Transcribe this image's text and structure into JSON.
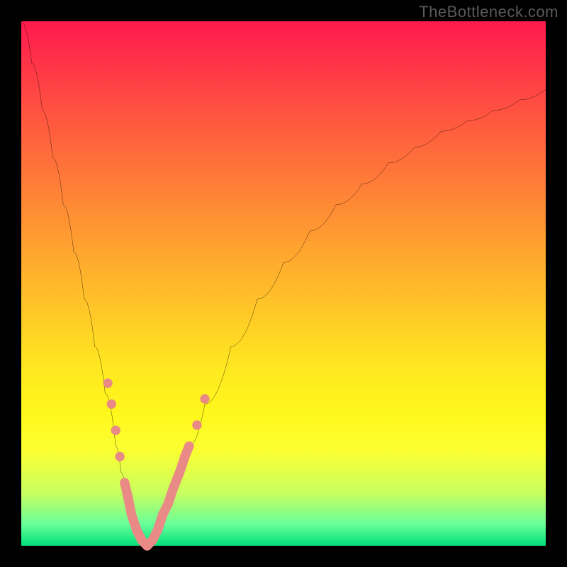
{
  "watermark": "TheBottleneck.com",
  "colors": {
    "frame": "#000000",
    "curve": "#000000",
    "marker_fill": "#e98a86",
    "marker_stroke": "#e98a86"
  },
  "chart_data": {
    "type": "line",
    "title": "",
    "xlabel": "",
    "ylabel": "",
    "xlim": [
      0,
      100
    ],
    "ylim": [
      0,
      100
    ],
    "grid": false,
    "background": "vertical-gradient red→yellow→green (bottleneck heatmap)",
    "series": [
      {
        "name": "bottleneck-curve",
        "x": [
          0,
          2,
          4,
          6,
          8,
          10,
          12,
          14,
          16,
          18,
          19,
          20,
          21,
          22,
          23,
          24,
          25,
          26,
          28,
          30,
          32,
          35,
          40,
          45,
          50,
          55,
          60,
          65,
          70,
          75,
          80,
          85,
          90,
          95,
          100
        ],
        "y": [
          100,
          92,
          83,
          74,
          65,
          56,
          47,
          38,
          29,
          19,
          14,
          10,
          6,
          3,
          1,
          0,
          1,
          3,
          7,
          13,
          19,
          27,
          38,
          47,
          54,
          60,
          65,
          69,
          73,
          76,
          79,
          81,
          83,
          85,
          87
        ]
      }
    ],
    "markers": {
      "comment": "salmon rounded markers overlaid near the valley and lower flanks",
      "points": [
        {
          "x": 16.5,
          "y": 31
        },
        {
          "x": 17.2,
          "y": 27
        },
        {
          "x": 18.0,
          "y": 22
        },
        {
          "x": 18.8,
          "y": 17
        },
        {
          "x": 19.7,
          "y": 12
        },
        {
          "x": 20.4,
          "y": 9
        },
        {
          "x": 21.0,
          "y": 6
        },
        {
          "x": 22.0,
          "y": 3
        },
        {
          "x": 23.0,
          "y": 1
        },
        {
          "x": 24.0,
          "y": 0
        },
        {
          "x": 25.0,
          "y": 1
        },
        {
          "x": 26.0,
          "y": 3
        },
        {
          "x": 27.0,
          "y": 6
        },
        {
          "x": 28.0,
          "y": 8
        },
        {
          "x": 29.0,
          "y": 11
        },
        {
          "x": 30.2,
          "y": 14
        },
        {
          "x": 31.2,
          "y": 17
        },
        {
          "x": 32.0,
          "y": 19
        },
        {
          "x": 33.5,
          "y": 23
        },
        {
          "x": 35.0,
          "y": 28
        }
      ]
    }
  }
}
